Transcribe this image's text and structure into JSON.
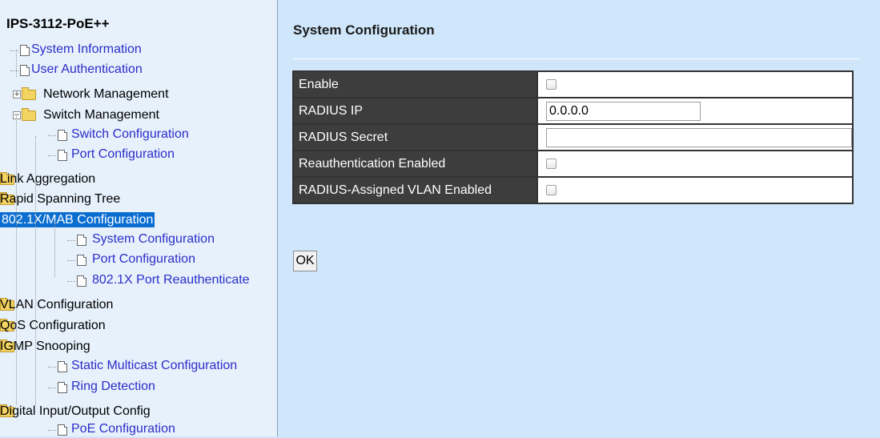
{
  "sidebar": {
    "title": "IPS-3112-PoE++",
    "tree": [
      {
        "type": "leaf",
        "level": 1,
        "label": "System Information"
      },
      {
        "type": "leaf",
        "level": 1,
        "label": "User Authentication"
      },
      {
        "type": "folder",
        "level": 0,
        "label": "Network Management",
        "expanded": false
      },
      {
        "type": "folder",
        "level": 0,
        "label": "Switch Management",
        "expanded": true
      },
      {
        "type": "leaf",
        "level": 2,
        "label": "Switch Configuration"
      },
      {
        "type": "leaf",
        "level": 2,
        "label": "Port Configuration"
      },
      {
        "type": "folder",
        "level": 1,
        "label": "Link Aggregation",
        "expanded": false
      },
      {
        "type": "folder",
        "level": 1,
        "label": "Rapid Spanning Tree",
        "expanded": false
      },
      {
        "type": "folder",
        "level": 1,
        "label": "802.1X/MAB Configuration",
        "expanded": true,
        "selected": true
      },
      {
        "type": "leaf",
        "level": 3,
        "label": "System Configuration"
      },
      {
        "type": "leaf",
        "level": 3,
        "label": "Port Configuration"
      },
      {
        "type": "leaf",
        "level": 3,
        "label": "802.1X Port Reauthenticate"
      },
      {
        "type": "folder",
        "level": 1,
        "label": "VLAN Configuration",
        "expanded": false
      },
      {
        "type": "folder",
        "level": 1,
        "label": "QoS Configuration",
        "expanded": false
      },
      {
        "type": "folder",
        "level": 1,
        "label": "IGMP Snooping",
        "expanded": false
      },
      {
        "type": "leaf",
        "level": 2,
        "label": "Static Multicast Configuration"
      },
      {
        "type": "leaf",
        "level": 2,
        "label": "Ring Detection"
      },
      {
        "type": "folder",
        "level": 1,
        "label": "Digital Input/Output Config",
        "expanded": false
      },
      {
        "type": "leaf",
        "level": 2,
        "label": "PoE Configuration"
      }
    ]
  },
  "main": {
    "title": "System Configuration",
    "rows": {
      "enable": {
        "label": "Enable",
        "checked": false
      },
      "radius_ip": {
        "label": "RADIUS IP",
        "value": "0.0.0.0"
      },
      "radius_secret": {
        "label": "RADIUS Secret",
        "value": ""
      },
      "reauth": {
        "label": "Reauthentication Enabled",
        "checked": false
      },
      "radius_vlan": {
        "label": "RADIUS-Assigned VLAN Enabled",
        "checked": false
      }
    },
    "ok_label": "OK"
  }
}
